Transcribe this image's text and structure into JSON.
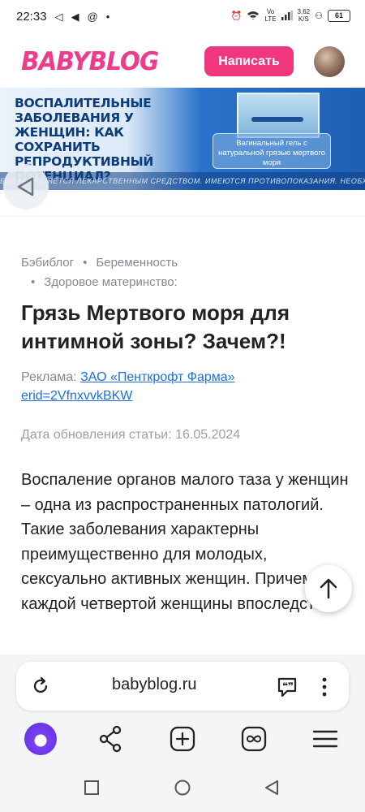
{
  "status_bar": {
    "time": "22:33",
    "net_speed": "3,62",
    "net_unit": "K/S",
    "battery": "61"
  },
  "header": {
    "logo": "BABYBLOG",
    "write_button": "Написать"
  },
  "banner": {
    "title": "ВОСПАЛИТЕЛЬНЫЕ ЗАБОЛЕВАНИЯ У ЖЕНЩИН: КАК СОХРАНИТЬ РЕПРОДУКТИВНЫЙ ПОТЕНЦИАЛ?",
    "product_tag": "Вагинальный гель с натуральной грязью мертвого моря",
    "disclaimer": "БАД НЕ ЯВЛЯЕТСЯ ЛЕКАРСТВЕННЫМ СРЕДСТВОМ. ИМЕЮТСЯ ПРОТИВОПОКАЗАНИЯ. НЕОБХОДИМА КОНСУЛЬТАЦИЯ СПЕЦИАЛИСТА"
  },
  "breadcrumbs": [
    "Бэбиблог",
    "Беременность",
    "Здоровое материнство:"
  ],
  "article": {
    "title": "Грязь Мертвого моря для интимной зоны? Зачем?!",
    "ad_label": "Реклама:",
    "ad_company": "ЗАО «Пенткрофт Фарма»",
    "ad_erid": "erid=2VfnxvvkBKW",
    "date": "Дата обновления статьи: 16.05.2024",
    "body": "Воспаление органов малого таза у женщин – одна из распространенных патологий. Такие заболевания характерны преимущественно для молодых, сексуально активных женщин. Причем у каждой четвертой женщины впоследствии"
  },
  "browser": {
    "url": "babyblog.ru"
  },
  "icons": [
    "reload-icon",
    "chat-quote-icon",
    "more-vert-icon",
    "alice-icon",
    "share-icon",
    "new-tab-icon",
    "tabs-icon",
    "menu-icon",
    "scroll-top-icon",
    "back-icon"
  ]
}
